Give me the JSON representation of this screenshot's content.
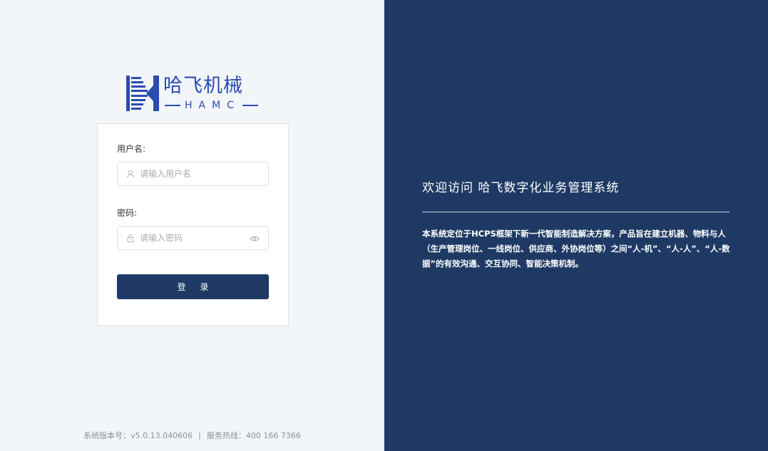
{
  "logo": {
    "name_cn": "哈飞机械",
    "name_en": "HAMC",
    "mark_icon": "hamc-logo-mark",
    "brand_color": "#2a4bb0"
  },
  "login_form": {
    "username_label": "用户名:",
    "username_placeholder": "请输入用户名",
    "username_value": "",
    "username_icon": "user-icon",
    "password_label": "密码:",
    "password_placeholder": "请输入密码",
    "password_value": "",
    "password_icon": "lock-icon",
    "password_toggle_icon": "eye-icon",
    "login_button": "登 录"
  },
  "footer": {
    "version_label": "系统版本号：",
    "version": "v5.0.13.040606",
    "separator": "|",
    "hotline_label": "服务热线：",
    "hotline": "400 166 7366"
  },
  "welcome": {
    "title": "欢迎访问 哈飞数字化业务管理系统",
    "description": "本系统定位于HCPS框架下新一代智能制造解决方案，产品旨在建立机器、物料与人（生产管理岗位、一线岗位、供应商、外协岗位等）之间“人-机”、“人-人”、“人-数据”的有效沟通、交互协同、智能决策机制。"
  },
  "colors": {
    "left_background": "#f3f6f9",
    "right_background": "#1e3a64",
    "primary_button": "#1e3a64",
    "logo_blue": "#2a4bb0"
  }
}
